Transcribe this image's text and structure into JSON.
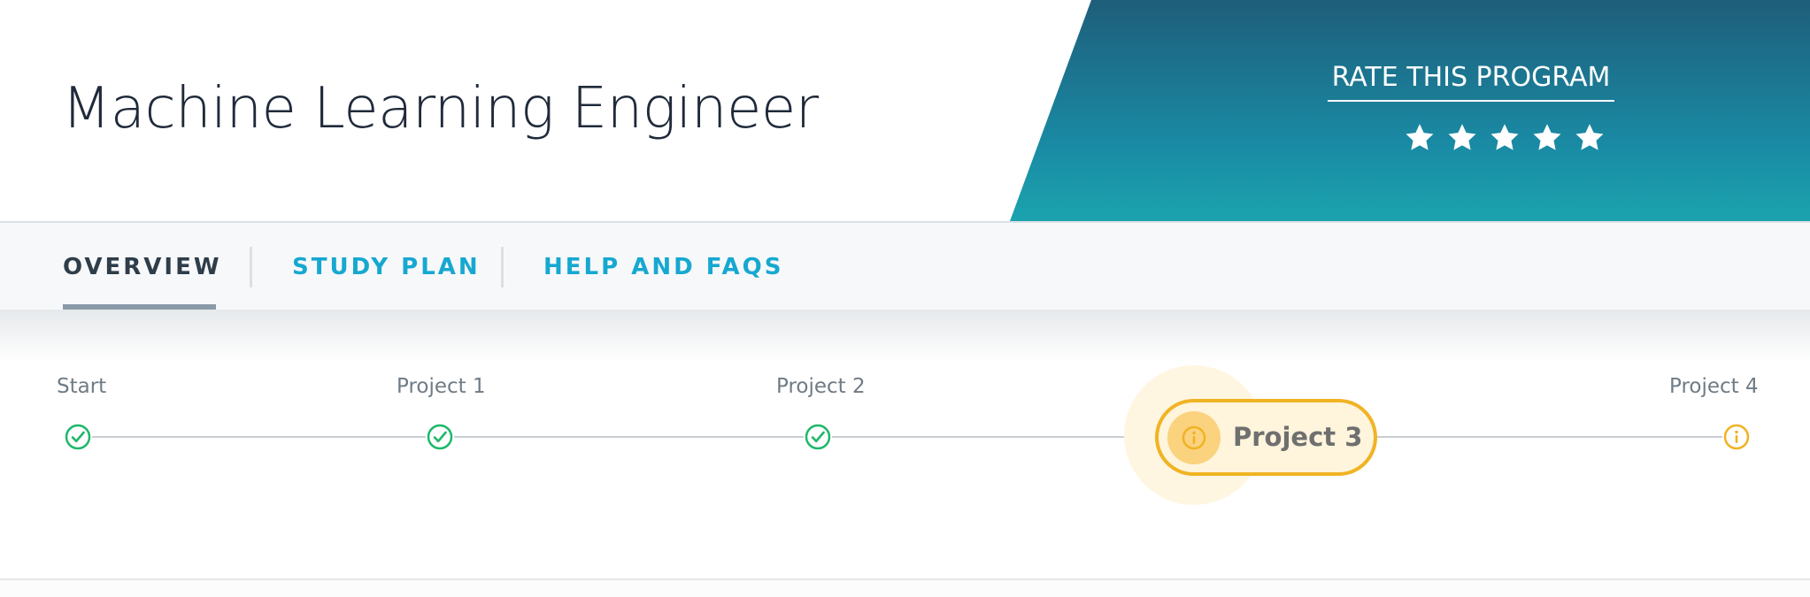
{
  "header": {
    "title": "Machine Learning Engineer",
    "banner": {
      "rate_label": "RATE THIS PROGRAM",
      "star_count": 5,
      "star_icon": "star-icon",
      "gradient_colors": [
        "#1e5e7a",
        "#1ba3ae"
      ]
    }
  },
  "nav": {
    "tabs": [
      {
        "label": "OVERVIEW",
        "active": true
      },
      {
        "label": "STUDY PLAN",
        "active": false
      },
      {
        "label": "HELP AND FAQS",
        "active": false
      }
    ],
    "active_color": "#2e3d49",
    "link_color": "#16a8d0"
  },
  "progress": {
    "milestones": [
      {
        "label": "Start",
        "status": "completed",
        "icon": "check-circle-icon"
      },
      {
        "label": "Project 1",
        "status": "completed",
        "icon": "check-circle-icon"
      },
      {
        "label": "Project 2",
        "status": "completed",
        "icon": "check-circle-icon"
      },
      {
        "label": "Project 3",
        "status": "current",
        "icon": "info-circle-icon"
      },
      {
        "label": "Project 4",
        "status": "pending",
        "icon": "info-circle-icon"
      }
    ],
    "colors": {
      "completed": "#1eb86a",
      "pending": "#f0b323"
    }
  }
}
